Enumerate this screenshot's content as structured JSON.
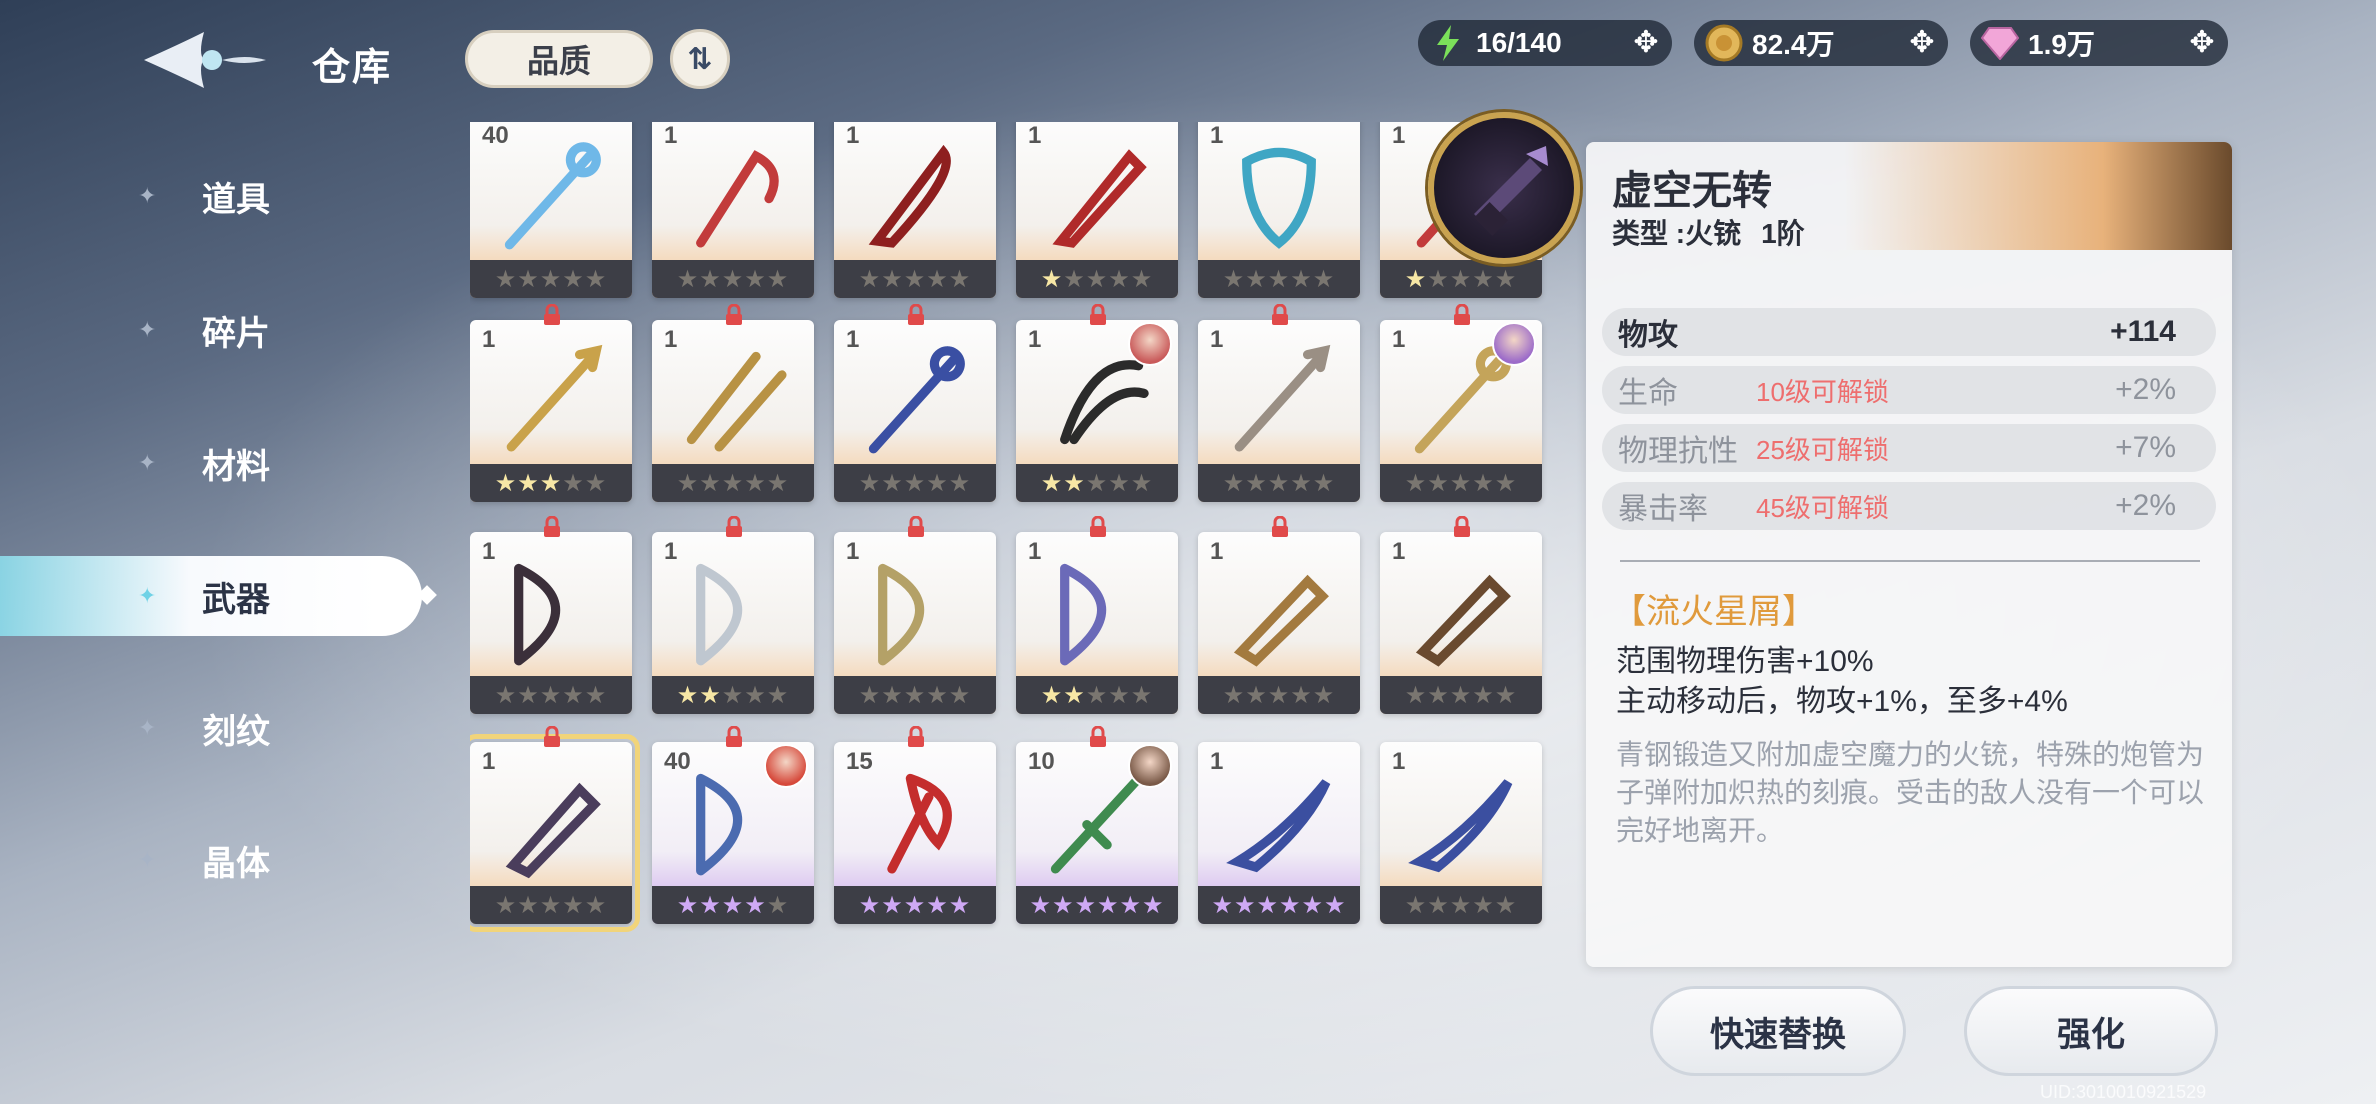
{
  "header": {
    "title": "仓库",
    "sort_label": "品质",
    "order_glyph": "⇅",
    "resources": [
      {
        "name": "stamina",
        "icon": "lightning-icon",
        "value": "16/140",
        "color": "#7be05a"
      },
      {
        "name": "gold",
        "icon": "gold-coin-icon",
        "value": "82.4万",
        "color": "#e2b75a"
      },
      {
        "name": "gems",
        "icon": "diamond-icon",
        "value": "1.9万",
        "color": "#f2a6d8"
      }
    ]
  },
  "nav": {
    "items": [
      {
        "label": "道具",
        "active": false
      },
      {
        "label": "碎片",
        "active": false
      },
      {
        "label": "材料",
        "active": false
      },
      {
        "label": "武器",
        "active": true
      },
      {
        "label": "刻纹",
        "active": false
      },
      {
        "label": "晶体",
        "active": false
      }
    ]
  },
  "grid": {
    "cards": [
      {
        "level": "40",
        "stars": 0,
        "rarity": "orange",
        "locked": false,
        "weapon_icon": "staff-icon",
        "color": "#6fb8e8"
      },
      {
        "level": "1",
        "stars": 0,
        "rarity": "orange",
        "locked": false,
        "weapon_icon": "scythe-icon",
        "color": "#c23b3b"
      },
      {
        "level": "1",
        "stars": 0,
        "rarity": "orange",
        "locked": false,
        "weapon_icon": "blade-icon",
        "color": "#8e1f1f"
      },
      {
        "level": "1",
        "stars": 1,
        "rarity": "orange",
        "locked": false,
        "weapon_icon": "greatsword-icon",
        "color": "#b02a2a"
      },
      {
        "level": "1",
        "stars": 0,
        "rarity": "orange",
        "locked": false,
        "weapon_icon": "shield-icon",
        "color": "#3fa6c4"
      },
      {
        "level": "1",
        "stars": 1,
        "rarity": "orange",
        "locked": false,
        "weapon_icon": "spear-icon",
        "color": "#c23b3b"
      },
      {
        "level": "1",
        "stars": 3,
        "rarity": "orange",
        "locked": true,
        "weapon_icon": "spear-icon",
        "color": "#c9a24a"
      },
      {
        "level": "1",
        "stars": 0,
        "rarity": "orange",
        "locked": true,
        "weapon_icon": "dual-blade-icon",
        "color": "#b89244"
      },
      {
        "level": "1",
        "stars": 0,
        "rarity": "orange",
        "locked": true,
        "weapon_icon": "staff-icon",
        "color": "#3a4fa3"
      },
      {
        "level": "1",
        "stars": 2,
        "rarity": "orange",
        "locked": true,
        "weapon_icon": "claw-icon",
        "color": "#2b2b2b",
        "portrait": "#c95a5a"
      },
      {
        "level": "1",
        "stars": 0,
        "rarity": "orange",
        "locked": true,
        "weapon_icon": "spear-icon",
        "color": "#9a8f84"
      },
      {
        "level": "1",
        "stars": 0,
        "rarity": "orange",
        "locked": true,
        "weapon_icon": "staff-icon",
        "color": "#c4a45a",
        "portrait": "#9c6bc9"
      },
      {
        "level": "1",
        "stars": 0,
        "rarity": "orange",
        "locked": true,
        "weapon_icon": "bow-icon",
        "color": "#3b2f3a"
      },
      {
        "level": "1",
        "stars": 2,
        "rarity": "orange",
        "locked": true,
        "weapon_icon": "bow-icon",
        "color": "#bfc7d0"
      },
      {
        "level": "1",
        "stars": 0,
        "rarity": "orange",
        "locked": true,
        "weapon_icon": "bow-icon",
        "color": "#b4a167"
      },
      {
        "level": "1",
        "stars": 2,
        "rarity": "orange",
        "locked": true,
        "weapon_icon": "bow-icon",
        "color": "#6b6ab8"
      },
      {
        "level": "1",
        "stars": 0,
        "rarity": "orange",
        "locked": true,
        "weapon_icon": "cannon-icon",
        "color": "#a37a3f"
      },
      {
        "level": "1",
        "stars": 0,
        "rarity": "orange",
        "locked": true,
        "weapon_icon": "cannon-icon",
        "color": "#6a4a2f"
      },
      {
        "level": "1",
        "stars": 0,
        "rarity": "orange",
        "locked": true,
        "selected": true,
        "weapon_icon": "blunderbuss-icon",
        "color": "#4a3d5c"
      },
      {
        "level": "40",
        "stars": 4,
        "rarity": "purple",
        "locked": true,
        "weapon_icon": "bow-icon",
        "color": "#4b6bb0",
        "portrait": "#d6493b"
      },
      {
        "level": "15",
        "stars": 5,
        "rarity": "purple",
        "locked": true,
        "weapon_icon": "axe-icon",
        "color": "#c42d2d"
      },
      {
        "level": "10",
        "stars": 6,
        "rarity": "purple",
        "locked": true,
        "weapon_icon": "sword-icon",
        "color": "#3f8b4f",
        "portrait": "#7a5a48"
      },
      {
        "level": "1",
        "stars": 6,
        "rarity": "purple",
        "locked": false,
        "weapon_icon": "glaive-icon",
        "color": "#3b4fa0"
      },
      {
        "level": "1",
        "stars": 0,
        "rarity": "orange",
        "locked": false,
        "weapon_icon": "glaive-icon",
        "color": "#3b4fa0"
      }
    ]
  },
  "detail": {
    "name": "虚空无转",
    "type": "类型 :火铳",
    "tier": "1阶",
    "stats": [
      {
        "name": "物攻",
        "unlock": "",
        "value": "+114",
        "locked": false
      },
      {
        "name": "生命",
        "unlock": "10级可解锁",
        "value": "+2%",
        "locked": true
      },
      {
        "name": "物理抗性",
        "unlock": "25级可解锁",
        "value": "+7%",
        "locked": true
      },
      {
        "name": "暴击率",
        "unlock": "45级可解锁",
        "value": "+2%",
        "locked": true
      }
    ],
    "skill_name": "【流火星屑】",
    "skill_desc": "范围物理伤害+10%\n主动移动后，物攻+1%，至多+4%",
    "lore": "青钢锻造又附加虚空魔力的火铳，特殊的炮管为子弹附加炽热的刻痕。受击的敌人没有一个可以完好地离开。"
  },
  "actions": {
    "quick_swap": "快速替换",
    "enhance": "强化"
  },
  "uid_text": "UID:3010010921529"
}
